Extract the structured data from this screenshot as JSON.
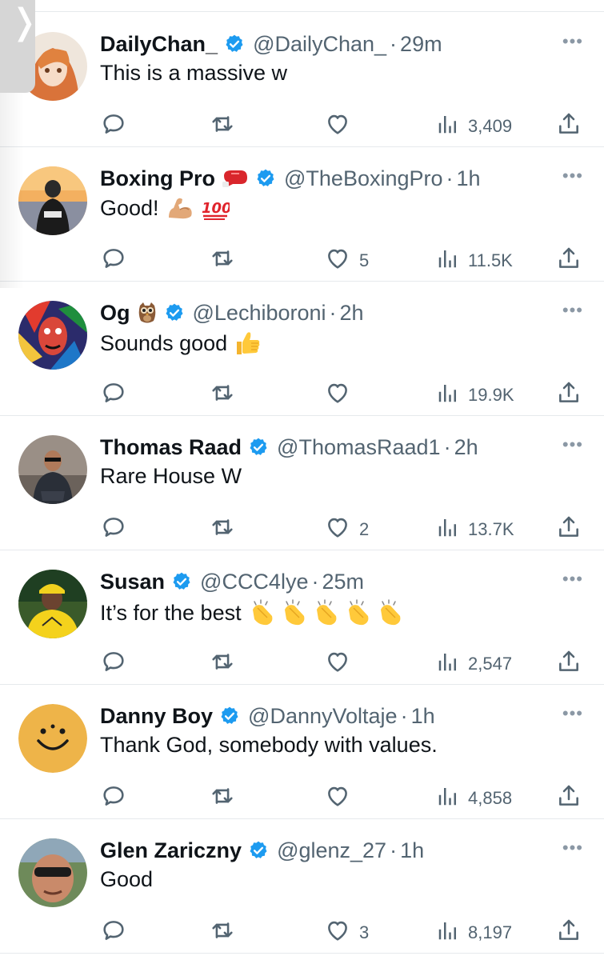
{
  "tweets": [
    {
      "name": "DailyChan_",
      "handle": "@DailyChan_",
      "time": "29m",
      "text": "This is a massive w",
      "likes": "",
      "views": "3,409",
      "avatar": "anime-avatar",
      "emoji": "",
      "text_emoji": ""
    },
    {
      "name": "Boxing Pro",
      "handle": "@TheBoxingPro",
      "time": "1h",
      "text": "Good!",
      "likes": "5",
      "views": "11.5K",
      "avatar": "beach-avatar",
      "emoji": "boxing-glove-icon",
      "text_emoji": "muscle-100-emoji"
    },
    {
      "name": "Og",
      "handle": "@Lechiboroni",
      "time": "2h",
      "text": "Sounds good",
      "likes": "",
      "views": "19.9K",
      "avatar": "art-avatar",
      "emoji": "owl-icon",
      "text_emoji": "thumbs-up-emoji"
    },
    {
      "name": "Thomas Raad",
      "handle": "@ThomasRaad1",
      "time": "2h",
      "text": "Rare House W",
      "likes": "2",
      "views": "13.7K",
      "avatar": "man-avatar",
      "emoji": "",
      "text_emoji": ""
    },
    {
      "name": "Susan",
      "handle": "@CCC4lye",
      "time": "25m",
      "text": "It’s for the best",
      "likes": "",
      "views": "2,547",
      "avatar": "yellow-avatar",
      "emoji": "",
      "text_emoji": "clapping-hands-emoji"
    },
    {
      "name": "Danny Boy",
      "handle": "@DannyVoltaje",
      "time": "1h",
      "text": "Thank God, somebody with values.",
      "likes": "",
      "views": "4,858",
      "avatar": "smiley-avatar",
      "emoji": "",
      "text_emoji": ""
    },
    {
      "name": "Glen Zariczny",
      "handle": "@glenz_27",
      "time": "1h",
      "text": "Good",
      "likes": "3",
      "views": "8,197",
      "avatar": "selfie-avatar",
      "emoji": "",
      "text_emoji": ""
    }
  ],
  "colors": {
    "accent": "#1d9bf0",
    "muted": "#536471",
    "divider": "#e6e9ec"
  }
}
